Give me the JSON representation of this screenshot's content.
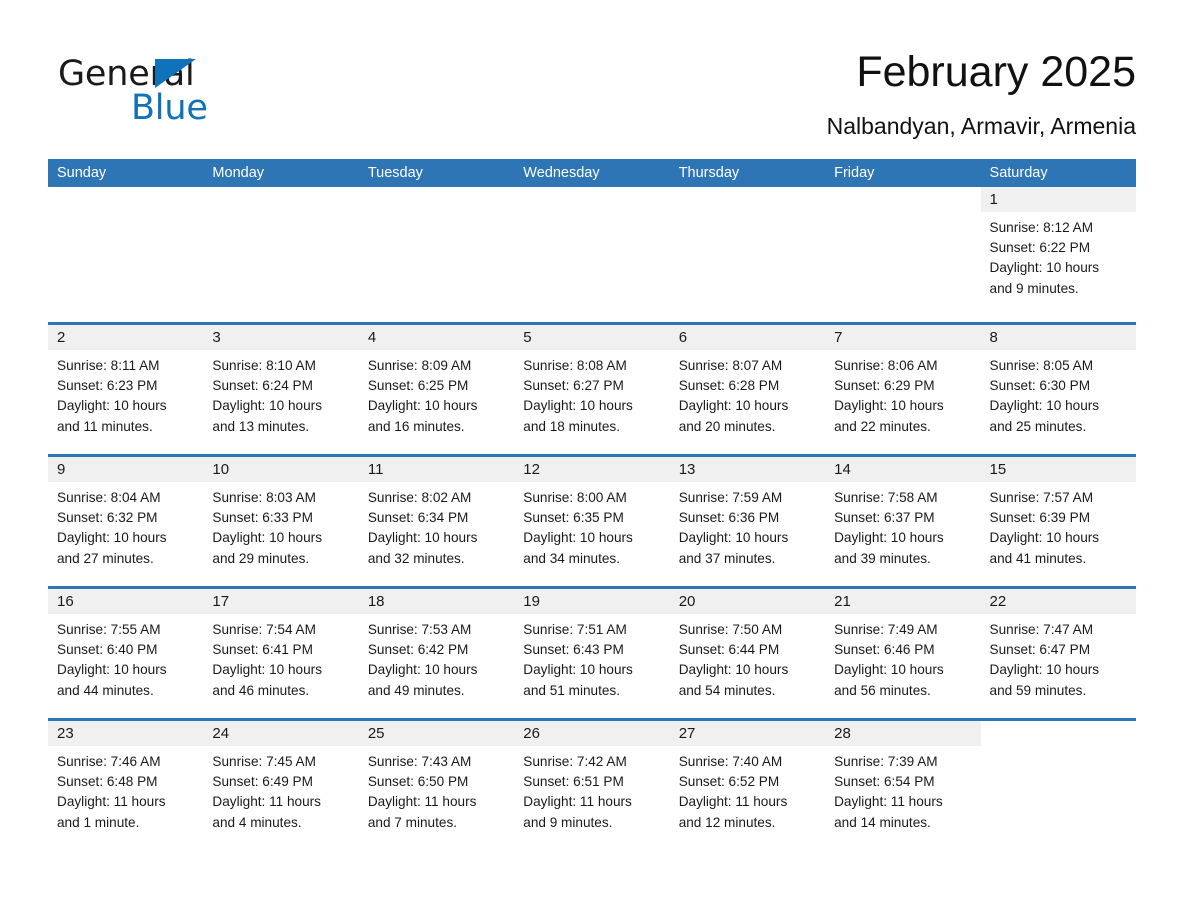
{
  "brand": {
    "name_part1": "General",
    "name_part2": "Blue",
    "accent_color": "#1072bb"
  },
  "header": {
    "title": "February 2025",
    "location": "Nalbandyan, Armavir, Armenia"
  },
  "calendar": {
    "header_color": "#2e75b6",
    "band_color": "#f0f0f0",
    "weekdays": [
      "Sunday",
      "Monday",
      "Tuesday",
      "Wednesday",
      "Thursday",
      "Friday",
      "Saturday"
    ],
    "weeks": [
      [
        {
          "day": "",
          "blank": true
        },
        {
          "day": "",
          "blank": true
        },
        {
          "day": "",
          "blank": true
        },
        {
          "day": "",
          "blank": true
        },
        {
          "day": "",
          "blank": true
        },
        {
          "day": "",
          "blank": true
        },
        {
          "day": "1",
          "sunrise": "Sunrise: 8:12 AM",
          "sunset": "Sunset: 6:22 PM",
          "daylight1": "Daylight: 10 hours",
          "daylight2": "and 9 minutes."
        }
      ],
      [
        {
          "day": "2",
          "sunrise": "Sunrise: 8:11 AM",
          "sunset": "Sunset: 6:23 PM",
          "daylight1": "Daylight: 10 hours",
          "daylight2": "and 11 minutes."
        },
        {
          "day": "3",
          "sunrise": "Sunrise: 8:10 AM",
          "sunset": "Sunset: 6:24 PM",
          "daylight1": "Daylight: 10 hours",
          "daylight2": "and 13 minutes."
        },
        {
          "day": "4",
          "sunrise": "Sunrise: 8:09 AM",
          "sunset": "Sunset: 6:25 PM",
          "daylight1": "Daylight: 10 hours",
          "daylight2": "and 16 minutes."
        },
        {
          "day": "5",
          "sunrise": "Sunrise: 8:08 AM",
          "sunset": "Sunset: 6:27 PM",
          "daylight1": "Daylight: 10 hours",
          "daylight2": "and 18 minutes."
        },
        {
          "day": "6",
          "sunrise": "Sunrise: 8:07 AM",
          "sunset": "Sunset: 6:28 PM",
          "daylight1": "Daylight: 10 hours",
          "daylight2": "and 20 minutes."
        },
        {
          "day": "7",
          "sunrise": "Sunrise: 8:06 AM",
          "sunset": "Sunset: 6:29 PM",
          "daylight1": "Daylight: 10 hours",
          "daylight2": "and 22 minutes."
        },
        {
          "day": "8",
          "sunrise": "Sunrise: 8:05 AM",
          "sunset": "Sunset: 6:30 PM",
          "daylight1": "Daylight: 10 hours",
          "daylight2": "and 25 minutes."
        }
      ],
      [
        {
          "day": "9",
          "sunrise": "Sunrise: 8:04 AM",
          "sunset": "Sunset: 6:32 PM",
          "daylight1": "Daylight: 10 hours",
          "daylight2": "and 27 minutes."
        },
        {
          "day": "10",
          "sunrise": "Sunrise: 8:03 AM",
          "sunset": "Sunset: 6:33 PM",
          "daylight1": "Daylight: 10 hours",
          "daylight2": "and 29 minutes."
        },
        {
          "day": "11",
          "sunrise": "Sunrise: 8:02 AM",
          "sunset": "Sunset: 6:34 PM",
          "daylight1": "Daylight: 10 hours",
          "daylight2": "and 32 minutes."
        },
        {
          "day": "12",
          "sunrise": "Sunrise: 8:00 AM",
          "sunset": "Sunset: 6:35 PM",
          "daylight1": "Daylight: 10 hours",
          "daylight2": "and 34 minutes."
        },
        {
          "day": "13",
          "sunrise": "Sunrise: 7:59 AM",
          "sunset": "Sunset: 6:36 PM",
          "daylight1": "Daylight: 10 hours",
          "daylight2": "and 37 minutes."
        },
        {
          "day": "14",
          "sunrise": "Sunrise: 7:58 AM",
          "sunset": "Sunset: 6:37 PM",
          "daylight1": "Daylight: 10 hours",
          "daylight2": "and 39 minutes."
        },
        {
          "day": "15",
          "sunrise": "Sunrise: 7:57 AM",
          "sunset": "Sunset: 6:39 PM",
          "daylight1": "Daylight: 10 hours",
          "daylight2": "and 41 minutes."
        }
      ],
      [
        {
          "day": "16",
          "sunrise": "Sunrise: 7:55 AM",
          "sunset": "Sunset: 6:40 PM",
          "daylight1": "Daylight: 10 hours",
          "daylight2": "and 44 minutes."
        },
        {
          "day": "17",
          "sunrise": "Sunrise: 7:54 AM",
          "sunset": "Sunset: 6:41 PM",
          "daylight1": "Daylight: 10 hours",
          "daylight2": "and 46 minutes."
        },
        {
          "day": "18",
          "sunrise": "Sunrise: 7:53 AM",
          "sunset": "Sunset: 6:42 PM",
          "daylight1": "Daylight: 10 hours",
          "daylight2": "and 49 minutes."
        },
        {
          "day": "19",
          "sunrise": "Sunrise: 7:51 AM",
          "sunset": "Sunset: 6:43 PM",
          "daylight1": "Daylight: 10 hours",
          "daylight2": "and 51 minutes."
        },
        {
          "day": "20",
          "sunrise": "Sunrise: 7:50 AM",
          "sunset": "Sunset: 6:44 PM",
          "daylight1": "Daylight: 10 hours",
          "daylight2": "and 54 minutes."
        },
        {
          "day": "21",
          "sunrise": "Sunrise: 7:49 AM",
          "sunset": "Sunset: 6:46 PM",
          "daylight1": "Daylight: 10 hours",
          "daylight2": "and 56 minutes."
        },
        {
          "day": "22",
          "sunrise": "Sunrise: 7:47 AM",
          "sunset": "Sunset: 6:47 PM",
          "daylight1": "Daylight: 10 hours",
          "daylight2": "and 59 minutes."
        }
      ],
      [
        {
          "day": "23",
          "sunrise": "Sunrise: 7:46 AM",
          "sunset": "Sunset: 6:48 PM",
          "daylight1": "Daylight: 11 hours",
          "daylight2": "and 1 minute."
        },
        {
          "day": "24",
          "sunrise": "Sunrise: 7:45 AM",
          "sunset": "Sunset: 6:49 PM",
          "daylight1": "Daylight: 11 hours",
          "daylight2": "and 4 minutes."
        },
        {
          "day": "25",
          "sunrise": "Sunrise: 7:43 AM",
          "sunset": "Sunset: 6:50 PM",
          "daylight1": "Daylight: 11 hours",
          "daylight2": "and 7 minutes."
        },
        {
          "day": "26",
          "sunrise": "Sunrise: 7:42 AM",
          "sunset": "Sunset: 6:51 PM",
          "daylight1": "Daylight: 11 hours",
          "daylight2": "and 9 minutes."
        },
        {
          "day": "27",
          "sunrise": "Sunrise: 7:40 AM",
          "sunset": "Sunset: 6:52 PM",
          "daylight1": "Daylight: 11 hours",
          "daylight2": "and 12 minutes."
        },
        {
          "day": "28",
          "sunrise": "Sunrise: 7:39 AM",
          "sunset": "Sunset: 6:54 PM",
          "daylight1": "Daylight: 11 hours",
          "daylight2": "and 14 minutes."
        },
        {
          "day": "",
          "blank": true
        }
      ]
    ]
  }
}
